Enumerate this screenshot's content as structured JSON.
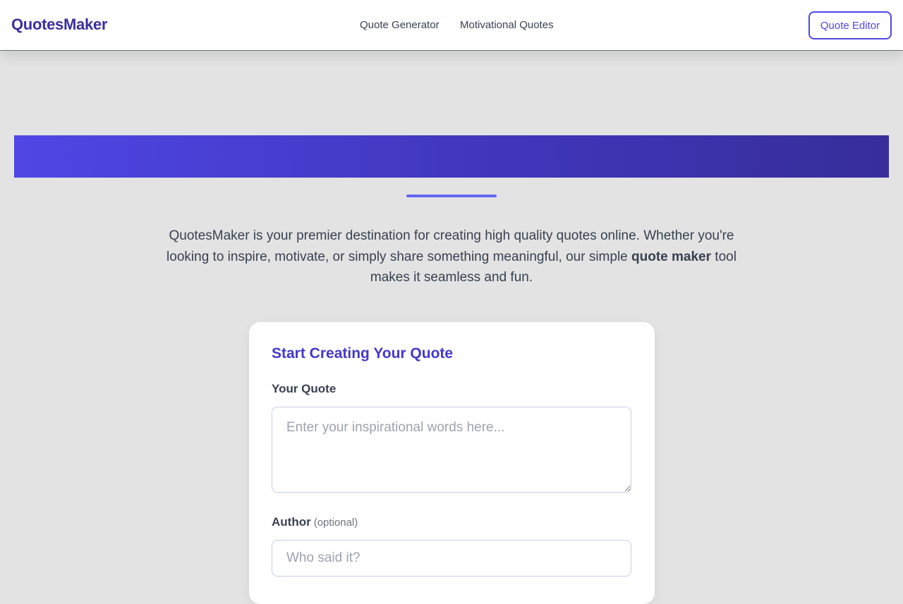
{
  "navbar": {
    "logo": "QuotesMaker",
    "links": [
      {
        "label": "Quote Generator"
      },
      {
        "label": "Motivational Quotes"
      }
    ],
    "editor_button": "Quote Editor"
  },
  "intro": {
    "text_before": "QuotesMaker is your premier destination for creating high quality quotes online. Whether you're looking to inspire, motivate, or simply share something meaningful, our simple ",
    "bold": "quote maker",
    "text_after": " tool makes it seamless and fun."
  },
  "form": {
    "title": "Start Creating Your Quote",
    "quote_label": "Your Quote",
    "quote_placeholder": "Enter your inspirational words here...",
    "quote_value": "",
    "author_label": "Author",
    "author_optional": "(optional)",
    "author_placeholder": "Who said it?",
    "author_value": ""
  },
  "colors": {
    "brand": "#3b2f9e",
    "accent": "#4f46e5",
    "title": "#4338ca",
    "background": "#e3e3e3"
  }
}
